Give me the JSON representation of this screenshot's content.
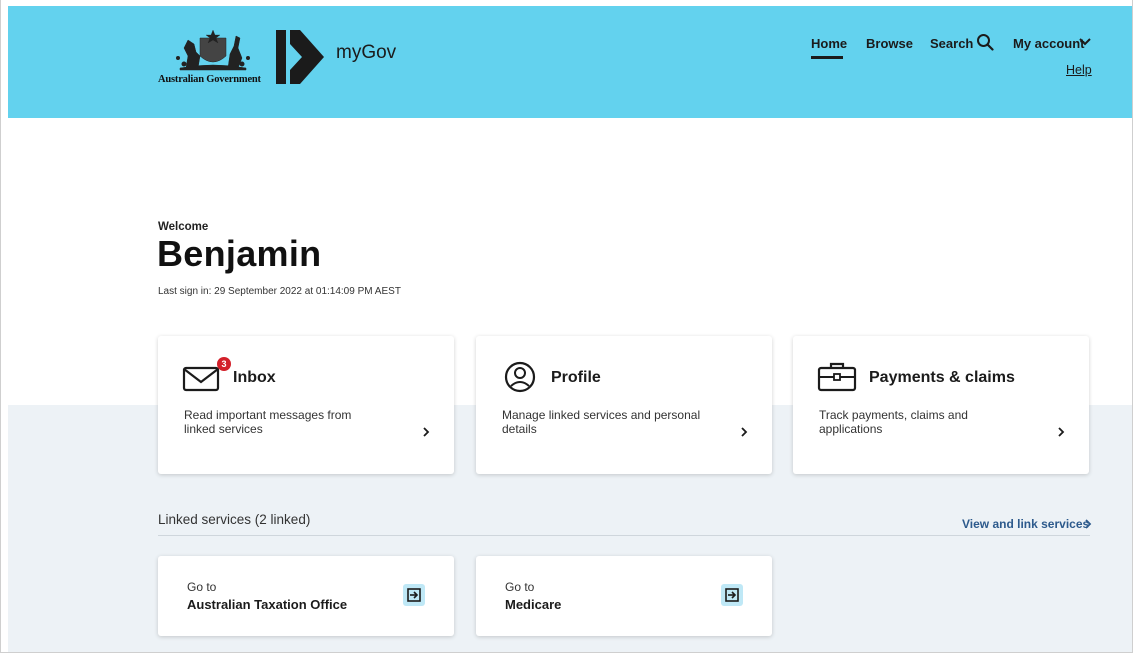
{
  "header": {
    "gov_label": "Australian Government",
    "brand": "myGov",
    "background_color": "#63d2ee"
  },
  "nav": {
    "home": "Home",
    "browse": "Browse",
    "search": "Search",
    "my_account": "My account",
    "help": "Help"
  },
  "welcome": {
    "label": "Welcome",
    "name": "Benjamin",
    "last_sign_in": "Last sign in: 29 September 2022 at 01:14:09 PM AEST"
  },
  "cards": [
    {
      "title": "Inbox",
      "description": "Read important messages from linked services",
      "icon": "mail-icon",
      "badge": "3"
    },
    {
      "title": "Profile",
      "description": "Manage linked services and personal details",
      "icon": "profile-icon"
    },
    {
      "title": "Payments & claims",
      "description": "Track payments, claims and applications",
      "icon": "briefcase-icon"
    }
  ],
  "linked": {
    "title": "Linked services (2 linked)",
    "link": "View and link services"
  },
  "services": [
    {
      "goto": "Go to",
      "name": "Australian Taxation Office"
    },
    {
      "goto": "Go to",
      "name": "Medicare"
    }
  ],
  "colors": {
    "badge": "#d3202a",
    "link": "#2d5a8c",
    "band": "#edf2f6",
    "service_icon_bg": "#bfe8f6"
  }
}
